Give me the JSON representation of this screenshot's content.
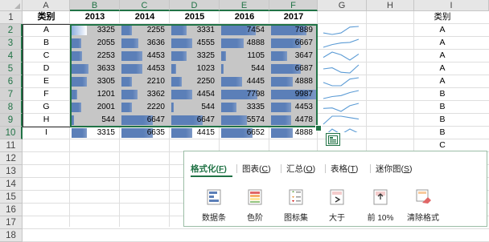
{
  "columns": [
    "A",
    "B",
    "C",
    "D",
    "E",
    "F",
    "G",
    "H",
    "I"
  ],
  "selected_columns": [
    "B",
    "C",
    "D",
    "E",
    "F"
  ],
  "rows": [
    "1",
    "2",
    "3",
    "4",
    "5",
    "6",
    "7",
    "8",
    "9",
    "10",
    "11",
    "12",
    "13",
    "14",
    "15",
    "16",
    "17",
    "18"
  ],
  "selected_rows": [
    "2",
    "3",
    "4",
    "5",
    "6",
    "7",
    "8",
    "9",
    "10"
  ],
  "header": {
    "category": "类别",
    "years": [
      "2013",
      "2014",
      "2015",
      "2016",
      "2017"
    ]
  },
  "categories": [
    "A",
    "B",
    "C",
    "D",
    "E",
    "F",
    "G",
    "H",
    "I"
  ],
  "values": [
    [
      3325,
      2255,
      3331,
      7454,
      7889
    ],
    [
      2055,
      3636,
      4555,
      4888,
      6667
    ],
    [
      2253,
      4453,
      3325,
      1105,
      3647
    ],
    [
      3633,
      4453,
      1023,
      544,
      6687
    ],
    [
      3305,
      2210,
      2250,
      4445,
      4888
    ],
    [
      1201,
      3362,
      4454,
      7798,
      9987
    ],
    [
      2001,
      2220,
      544,
      3335,
      4453
    ],
    [
      544,
      6647,
      6647,
      5574,
      4478
    ],
    [
      3315,
      6635,
      4415,
      6652,
      4888
    ]
  ],
  "data_bar_max": 9987,
  "colors": {
    "bar_blue": "#5b7fb8",
    "bar_light": "#8fb0e0",
    "selection_fill": "#c6c6c6",
    "accent": "#217346",
    "sparkline": "#5b9bd5"
  },
  "column_i": {
    "header": "类别",
    "values": [
      "A",
      "A",
      "A",
      "A",
      "A",
      "B",
      "B",
      "B",
      "B",
      "C",
      "C"
    ]
  },
  "quick_analysis": {
    "button_icon": "quick-analysis-icon",
    "tabs": [
      {
        "label": "格式化(",
        "key": "F",
        "suffix": ")",
        "active": true
      },
      {
        "label": "图表(",
        "key": "C",
        "suffix": ")",
        "active": false
      },
      {
        "label": "汇总(",
        "key": "O",
        "suffix": ")",
        "active": false
      },
      {
        "label": "表格(",
        "key": "T",
        "suffix": ")",
        "active": false
      },
      {
        "label": "迷你图(",
        "key": "S",
        "suffix": ")",
        "active": false
      }
    ],
    "tools": [
      {
        "label": "数据条",
        "icon": "data-bars-icon"
      },
      {
        "label": "色阶",
        "icon": "color-scale-icon"
      },
      {
        "label": "图标集",
        "icon": "icon-set-icon"
      },
      {
        "label": "大于",
        "icon": "greater-than-icon"
      },
      {
        "label": "前 10%",
        "icon": "top-10-percent-icon"
      },
      {
        "label": "清除格式",
        "icon": "clear-format-icon"
      }
    ]
  }
}
